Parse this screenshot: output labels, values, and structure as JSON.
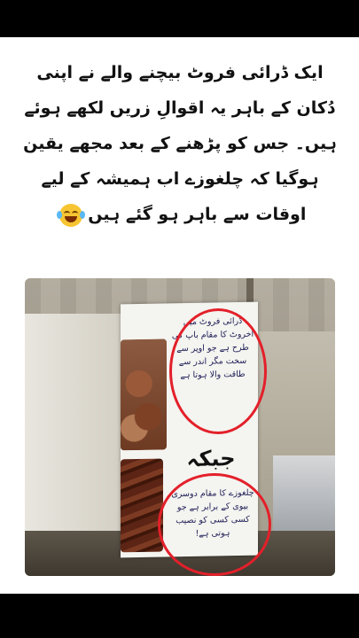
{
  "caption": {
    "lines": [
      "ایک ڈرائی فروٹ بیچنے والے نے اپنی",
      "دُکان کے باہر یہ اقوالِ زریں لکھے ہوئے",
      "ہیں۔ جس کو پڑھنے کے بعد مجھے یقین",
      "ہوگیا کہ چلغوزے اب ہمیشہ کے لیے",
      "اوقات سے باہر ہو گئے ہیں"
    ],
    "emoji": "laughing-tears-emoji"
  },
  "banner": {
    "top_text": "ڈرائی فروٹ میں اخروٹ کا مقام باپ کی طرح ہے جو اوپر سے سخت مگر اندر سے طاقت والا ہوتا ہے",
    "heading": "جبکہ",
    "bottom_text": "چلغوزے کا مقام دوسری بیوی کے برابر ہے جو کسی کسی کو نصیب ہوتی ہے!"
  },
  "colors": {
    "background": "#000000",
    "card": "#ffffff",
    "circle": "#e3202a"
  }
}
